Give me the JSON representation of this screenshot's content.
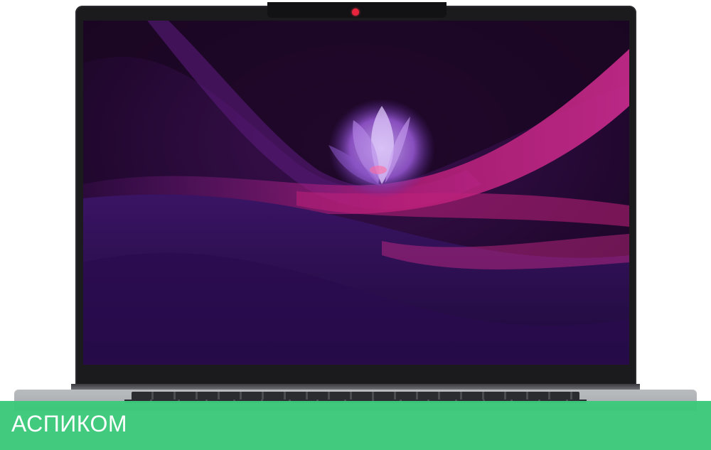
{
  "banner": {
    "brand_text": "АСПИКОМ",
    "color": "#3cc87a"
  },
  "device": {
    "camera_color": "#e8243c",
    "bezel_color": "#1b1b1e",
    "body_color": "#b0b3b6"
  },
  "wallpaper": {
    "colors": [
      "#2a0b3a",
      "#5a1a7a",
      "#c0207a",
      "#3a1060"
    ]
  }
}
